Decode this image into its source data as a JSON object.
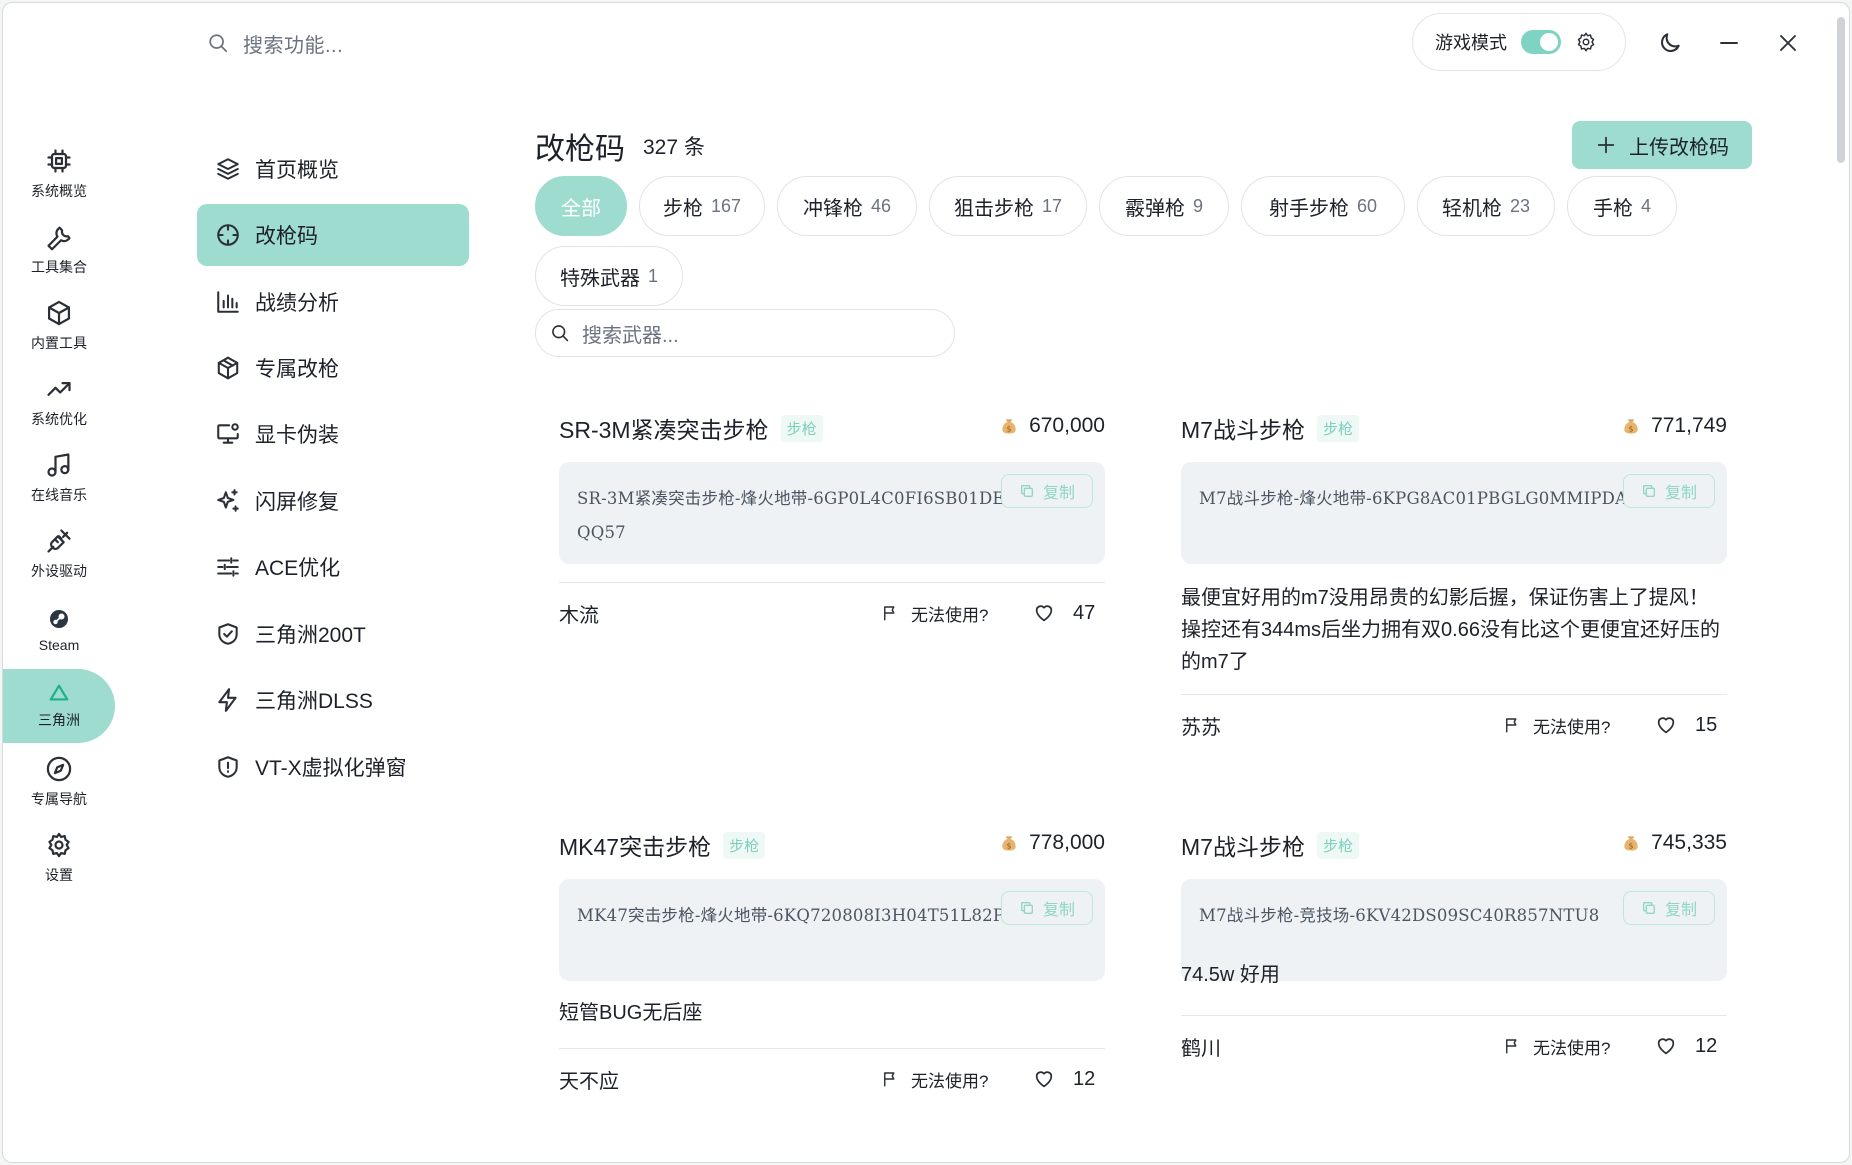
{
  "topbar": {
    "search_placeholder": "搜索功能...",
    "game_mode_label": "游戏模式",
    "game_mode_on": true
  },
  "rail": [
    {
      "label": "系统概览",
      "icon": "chip-icon"
    },
    {
      "label": "工具集合",
      "icon": "wrench-icon"
    },
    {
      "label": "内置工具",
      "icon": "cube-icon"
    },
    {
      "label": "系统优化",
      "icon": "trend-up-icon"
    },
    {
      "label": "在线音乐",
      "icon": "music-note-icon"
    },
    {
      "label": "外设驱动",
      "icon": "plug-icon"
    },
    {
      "label": "Steam",
      "icon": "steam-icon"
    },
    {
      "label": "三角洲",
      "icon": "delta-icon",
      "active": true
    },
    {
      "label": "专属导航",
      "icon": "compass-icon"
    },
    {
      "label": "设置",
      "icon": "gear-icon"
    }
  ],
  "menu": [
    {
      "label": "首页概览",
      "icon": "layers-icon"
    },
    {
      "label": "改枪码",
      "icon": "crosshair-icon",
      "active": true
    },
    {
      "label": "战绩分析",
      "icon": "bar-chart-icon"
    },
    {
      "label": "专属改枪",
      "icon": "box-icon"
    },
    {
      "label": "显卡伪装",
      "icon": "monitor-gear-icon"
    },
    {
      "label": "闪屏修复",
      "icon": "sparkle-icon"
    },
    {
      "label": "ACE优化",
      "icon": "sliders-icon"
    },
    {
      "label": "三角洲200T",
      "icon": "shield-check-icon"
    },
    {
      "label": "三角洲DLSS",
      "icon": "lightning-icon"
    },
    {
      "label": "VT-X虚拟化弹窗",
      "icon": "shield-alert-icon"
    }
  ],
  "main": {
    "title": "改枪码",
    "count": "327 条",
    "upload_label": "上传改枪码",
    "weapon_search_placeholder": "搜索武器...",
    "filters": [
      {
        "label": "全部",
        "count": "",
        "active": true
      },
      {
        "label": "步枪",
        "count": "167"
      },
      {
        "label": "冲锋枪",
        "count": "46"
      },
      {
        "label": "狙击步枪",
        "count": "17"
      },
      {
        "label": "霰弹枪",
        "count": "9"
      },
      {
        "label": "射手步枪",
        "count": "60"
      },
      {
        "label": "轻机枪",
        "count": "23"
      },
      {
        "label": "手枪",
        "count": "4"
      },
      {
        "label": "特殊武器",
        "count": "1"
      }
    ]
  },
  "cards": [
    {
      "name": "SR-3M紧凑突击步枪",
      "tag": "步枪",
      "price": "670,000",
      "code": "SR-3M紧凑突击步枪-烽火地带-6GP0L4C0FI6SB01DEQQ57",
      "copy_label": "复制",
      "description": "",
      "author": "木流",
      "report_label": "无法使用?",
      "likes": "47"
    },
    {
      "name": "M7战斗步枪",
      "tag": "步枪",
      "price": "771,749",
      "code": "M7战斗步枪-烽火地带-6KPG8AC01PBGLG0MMIPDA",
      "copy_label": "复制",
      "description": "最便宜好用的m7没用昂贵的幻影后握，保证伤害上了提风！操控还有344ms后坐力拥有双0.66没有比这个更便宜还好压的的m7了",
      "author": "苏苏",
      "report_label": "无法使用?",
      "likes": "15"
    },
    {
      "name": "MK47突击步枪",
      "tag": "步枪",
      "price": "778,000",
      "code": "MK47突击步枪-烽火地带-6KQ720808I3H04T51L82P",
      "copy_label": "复制",
      "description": "短管BUG无后座",
      "author": "天不应",
      "report_label": "无法使用?",
      "likes": "12"
    },
    {
      "name": "M7战斗步枪",
      "tag": "步枪",
      "price": "745,335",
      "code": "M7战斗步枪-竞技场-6KV42DS09SC40R857NTU8",
      "copy_label": "复制",
      "description": "74.5w 好用",
      "author": "鹤川",
      "report_label": "无法使用?",
      "likes": "12"
    }
  ],
  "colors": {
    "accent": "#9ddccf",
    "accent_text": "#7fcfbf",
    "code_bg": "#eef2f5"
  }
}
